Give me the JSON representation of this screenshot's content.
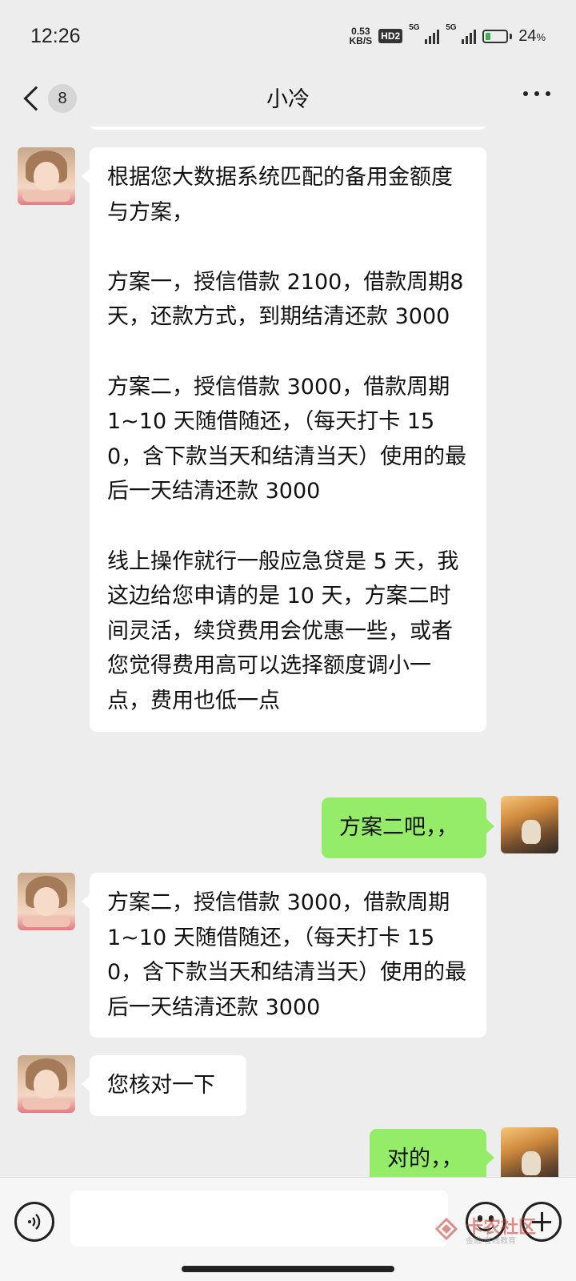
{
  "status_bar": {
    "time": "12:26",
    "net_speed_value": "0.53",
    "net_speed_unit": "KB/S",
    "hd_badge": "HD2",
    "signal1_label": "5G",
    "signal2_label": "5G",
    "battery_percent": "24",
    "battery_percent_sign": "%",
    "battery_level": 0.24,
    "battery_color": "#3bb34a"
  },
  "header": {
    "unread_count": "8",
    "title": "小冷"
  },
  "messages": [
    {
      "direction": "incoming",
      "text": "根据您大数据系统匹配的备用金额度与方案，\n\n方案一，授信借款 2100，借款周期8天，还款方式，到期结清还款 3000\n\n方案二，授信借款 3000，借款周期 1~10 天随借随还，（每天打卡 150，含下款当天和结清当天）使用的最后一天结清还款 3000\n\n线上操作就行一般应急贷是 5 天，我这边给您申请的是 10 天，方案二时间灵活，续贷费用会优惠一些，或者您觉得费用高可以选择额度调小一点，费用也低一点"
    },
    {
      "direction": "outgoing",
      "text": "方案二吧，，"
    },
    {
      "direction": "incoming",
      "text": "方案二，授信借款 3000，借款周期 1~10 天随借随还，（每天打卡 150，含下款当天和结清当天）使用的最后一天结清还款 3000"
    },
    {
      "direction": "incoming",
      "text": "您核对一下"
    },
    {
      "direction": "outgoing",
      "text": "对的，，"
    }
  ],
  "input_bar": {
    "placeholder": "",
    "watermark_text": "卡农社区",
    "watermark_sub": "金融·在线教育"
  },
  "colors": {
    "background": "#ededed",
    "incoming_bubble": "#ffffff",
    "outgoing_bubble": "#95ec69"
  }
}
